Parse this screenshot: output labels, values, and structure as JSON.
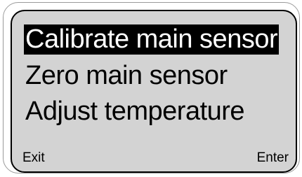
{
  "menu": {
    "items": [
      {
        "label": "Calibrate main sensor",
        "selected": true
      },
      {
        "label": "Zero main sensor",
        "selected": false
      },
      {
        "label": "Adjust temperature",
        "selected": false
      }
    ]
  },
  "softkeys": {
    "left": "Exit",
    "right": "Enter"
  },
  "colors": {
    "screen_background": "#d3d3d3",
    "selection_background": "#000000",
    "selection_text": "#ffffff",
    "text": "#000000"
  }
}
